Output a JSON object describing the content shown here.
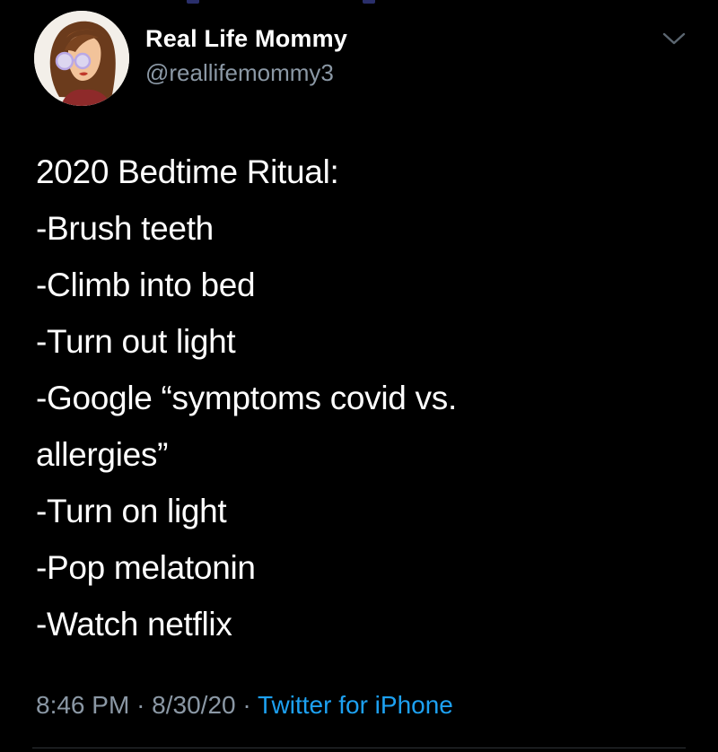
{
  "user": {
    "display_name": "Real Life Mommy",
    "handle": "@reallifemommy3"
  },
  "tweet": {
    "lines": [
      "2020 Bedtime Ritual:",
      "-Brush teeth",
      "-Climb into bed",
      "-Turn out light",
      "-Google “symptoms covid vs.",
      "allergies”",
      "-Turn on light",
      "-Pop melatonin",
      "-Watch netflix"
    ],
    "time": "8:46 PM",
    "date": "8/30/20",
    "separator": "·",
    "source": "Twitter for iPhone"
  },
  "icons": {
    "menu": "chevron-down-icon",
    "avatar": "avatar-icon"
  },
  "colors": {
    "background": "#000000",
    "text": "#ffffff",
    "secondary_text": "#8b98a5",
    "link": "#1da1f2"
  }
}
